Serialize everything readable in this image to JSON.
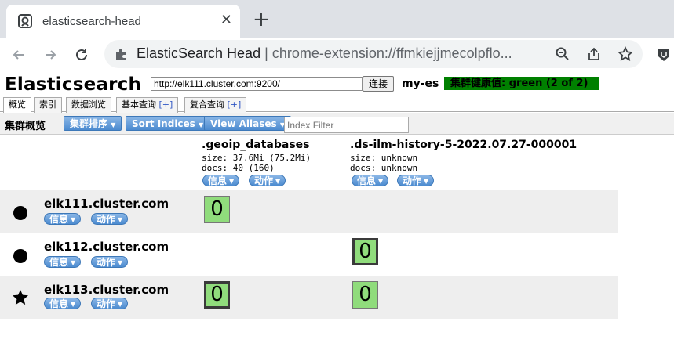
{
  "browser": {
    "tab_title": "elasticsearch-head",
    "omnibox": {
      "site_name": "ElasticSearch Head",
      "separator": "|",
      "url": "chrome-extension://ffmkiejjmecolpflo..."
    }
  },
  "header": {
    "title": "Elasticsearch",
    "connect_url": "http://elk111.cluster.com:9200/",
    "connect_label": "连接",
    "cluster_name": "my-es",
    "health_text": "集群健康值: green (2 of 2)",
    "health_color": "#008000"
  },
  "tabs": [
    {
      "label": "概览"
    },
    {
      "label": "索引"
    },
    {
      "label": "数据浏览"
    },
    {
      "label": "基本查询",
      "plus": "[+]"
    },
    {
      "label": "复合查询",
      "plus": "[+]"
    }
  ],
  "overview": {
    "label": "集群概览",
    "sort_cluster": "集群排序",
    "sort_indices": "Sort Indices",
    "view_aliases": "View Aliases",
    "index_filter_placeholder": "Index Filter"
  },
  "pills": {
    "info": "信息",
    "action": "动作"
  },
  "indices": [
    {
      "name": ".geoip_databases",
      "size": "size: 37.6Mi (75.2Mi)",
      "docs": "docs: 40 (160)"
    },
    {
      "name": ".ds-ilm-history-5-2022.07.27-000001",
      "size": "size: unknown",
      "docs": "docs: unknown"
    }
  ],
  "nodes": [
    {
      "name": "elk111.cluster.com",
      "symbol": "circle-icon",
      "shards": [
        "0",
        ""
      ]
    },
    {
      "name": "elk112.cluster.com",
      "symbol": "circle-icon",
      "shards": [
        "",
        "0"
      ]
    },
    {
      "name": "elk113.cluster.com",
      "symbol": "star-icon",
      "shards": [
        "0",
        "0"
      ]
    }
  ],
  "colors": {
    "shard": "#90dc7c",
    "button": "#4c8bd0",
    "row_shade": "#eeeeee"
  }
}
